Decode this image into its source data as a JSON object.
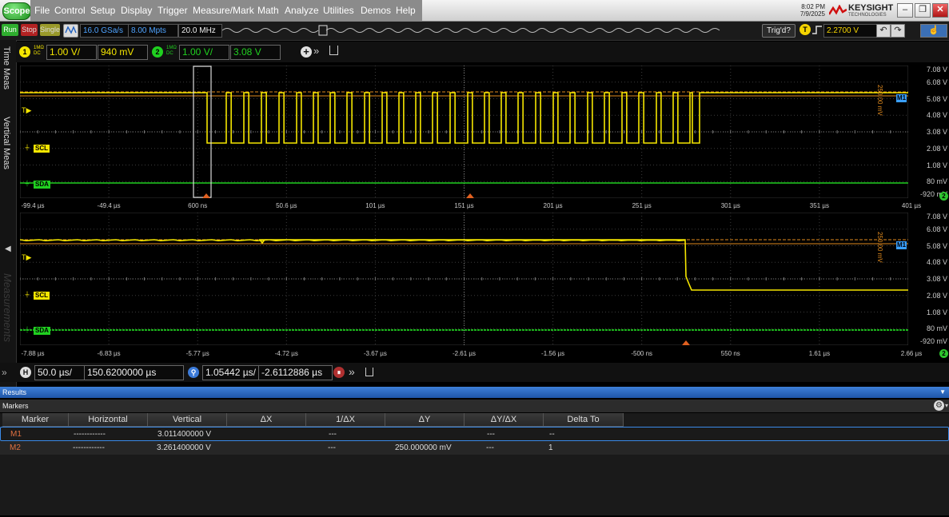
{
  "app": {
    "logo": "Scope"
  },
  "menu": [
    "File",
    "Control",
    "Setup",
    "Display",
    "Trigger",
    "Measure/Mark",
    "Math",
    "Analyze",
    "Utilities",
    "Demos",
    "Help"
  ],
  "clock": {
    "time": "8:02 PM",
    "date": "7/9/2025"
  },
  "brand": {
    "name": "KEYSIGHT",
    "sub": "TECHNOLOGIES"
  },
  "toolbar": {
    "run": "Run",
    "stop": "Stop",
    "single": "Single",
    "sample_rate": "16.0 GSa/s",
    "memory": "8.00 Mpts",
    "bandwidth": "20.0 MHz",
    "trigd": "Trig'd?",
    "trigger_source": "T",
    "trigger_level": "2.2700 V"
  },
  "side_tabs": {
    "meas": "Time Meas",
    "vertical": "Vertical Meas",
    "measurements": "Measurements"
  },
  "channels": [
    {
      "num": "1",
      "coupling_top": "1MΩ",
      "coupling_bottom": "DC",
      "scale": "1.00 V/",
      "offset": "940 mV",
      "color": "#f5e600"
    },
    {
      "num": "2",
      "coupling_top": "1MΩ",
      "coupling_bottom": "DC",
      "scale": "1.00 V/",
      "offset": "3.08 V",
      "color": "#20d020"
    }
  ],
  "plot_labels": {
    "scl": "SCL",
    "sda": "SDA",
    "trigger_marker": "T",
    "marker": "M1",
    "delta": "250.00 mV"
  },
  "vertical_ticks": [
    "7.08 V",
    "6.08 V",
    "5.08 V",
    "4.08 V",
    "3.08 V",
    "2.08 V",
    "1.08 V",
    "80 mV",
    "-920 mV"
  ],
  "plot1_time_ticks": [
    "-99.4 µs",
    "-49.4 µs",
    "600 ns",
    "50.6 µs",
    "101 µs",
    "151 µs",
    "201 µs",
    "251 µs",
    "301 µs",
    "351 µs",
    "401 µs"
  ],
  "plot2_time_ticks": [
    "-7.88 µs",
    "-6.83 µs",
    "-5.77 µs",
    "-4.72 µs",
    "-3.67 µs",
    "-2.61 µs",
    "-1.56 µs",
    "-500 ns",
    "550 ns",
    "1.61 µs",
    "2.66 µs"
  ],
  "channel_badge": "2",
  "horizontal": {
    "label": "H",
    "scale": "50.0 µs/",
    "position": "150.6200000 µs",
    "zoom_scale": "1.05442 µs/",
    "zoom_position": "-2.6112886 µs"
  },
  "results": {
    "title": "Results",
    "markers_title": "Markers"
  },
  "table": {
    "headers": [
      "Marker",
      "Horizontal",
      "Vertical",
      "ΔX",
      "1/ΔX",
      "ΔY",
      "ΔY/ΔX",
      "Delta To"
    ],
    "rows": [
      [
        "M1",
        "------------",
        "3.011400000 V",
        "",
        "---",
        "",
        "---",
        "--"
      ],
      [
        "M2",
        "------------",
        "3.261400000 V",
        "",
        "---",
        "250.000000 mV",
        "---",
        "1"
      ]
    ]
  }
}
